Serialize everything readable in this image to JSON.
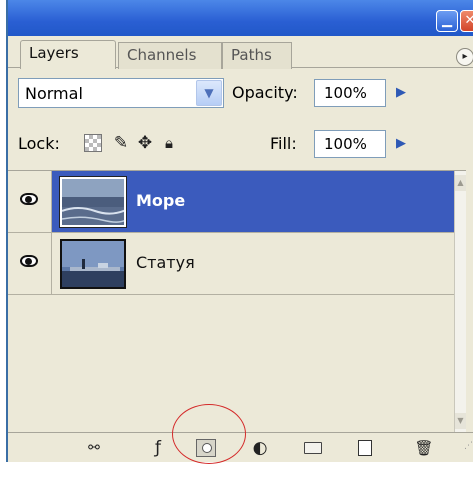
{
  "window": {
    "minimize_icon": "minimize-icon",
    "close_icon": "close-icon"
  },
  "tabs": [
    {
      "label": "Layers",
      "active": true
    },
    {
      "label": "Channels",
      "active": false
    },
    {
      "label": "Paths",
      "active": false
    }
  ],
  "blend_mode": {
    "value": "Normal"
  },
  "opacity": {
    "label": "Opacity:",
    "value": "100%"
  },
  "lock": {
    "label": "Lock:",
    "icons": [
      "lock-transparent-icon",
      "lock-brush-icon",
      "lock-move-icon",
      "lock-all-icon"
    ]
  },
  "fill": {
    "label": "Fill:",
    "value": "100%"
  },
  "layers": [
    {
      "name": "Море",
      "selected": true,
      "visible": true
    },
    {
      "name": "Статуя",
      "selected": false,
      "visible": true
    }
  ],
  "toolbar_icons": [
    "link-layers-icon",
    "layer-style-icon",
    "add-mask-icon",
    "adjustment-layer-icon",
    "new-group-icon",
    "new-layer-icon",
    "trash-icon"
  ],
  "colors": {
    "panel_bg": "#ece9d8",
    "selection": "#3b5bbd",
    "title_blue": "#2a5fd3",
    "highlight_red": "#d42a2a"
  }
}
